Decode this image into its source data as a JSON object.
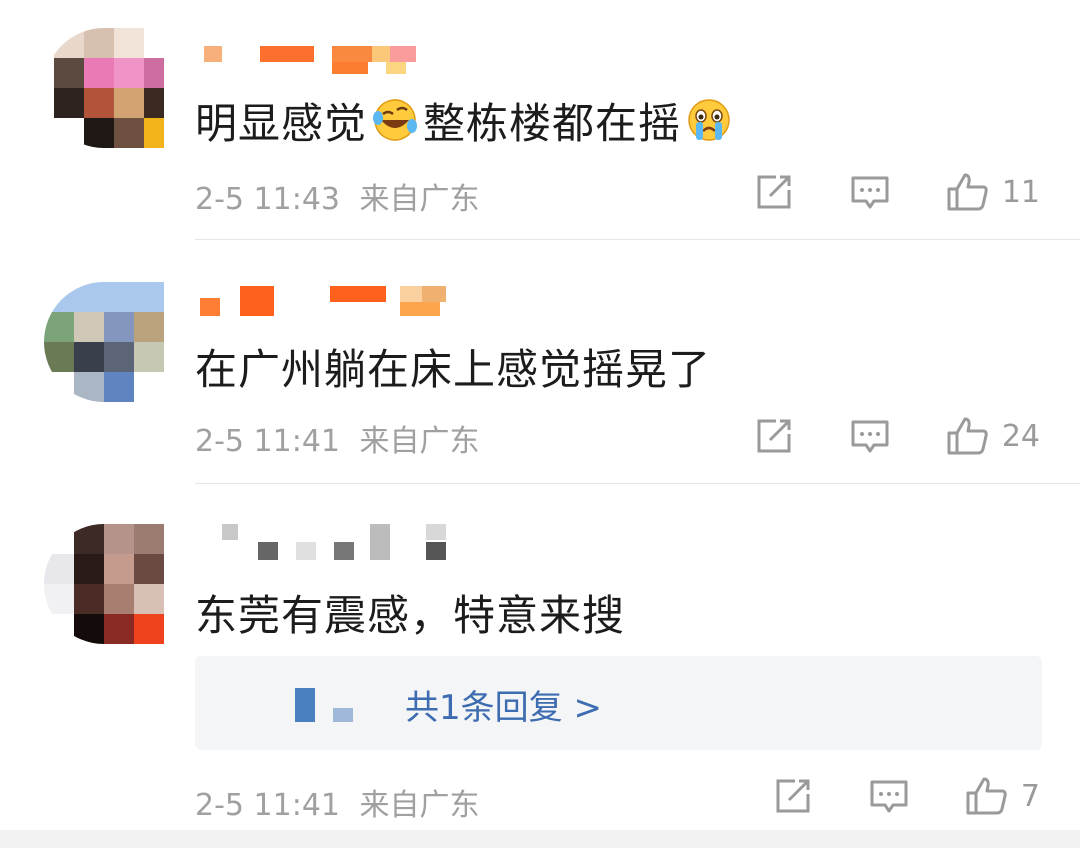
{
  "comments": [
    {
      "text_before_emoji": "明显感觉",
      "text_after_emoji": "整栋楼都在摇",
      "emoji_1": "laughing-crying-emoji",
      "emoji_2": "crying-emoji",
      "timestamp": "2-5 11:43",
      "location": "来自广东",
      "likes": "11"
    },
    {
      "text": "在广州躺在床上感觉摇晃了",
      "timestamp": "2-5 11:41",
      "location": "来自广东",
      "likes": "24"
    },
    {
      "text": "东莞有震感，特意来搜",
      "reply_summary": "共1条回复 >",
      "timestamp": "2-5 11:41",
      "location": "来自广东",
      "likes": "7"
    }
  ],
  "icons": {
    "share": "share-icon",
    "comment": "comment-icon",
    "like": "thumbs-up-icon"
  },
  "colors": {
    "link": "#3d6cb0",
    "meta": "#a0a0a0",
    "text": "#1c1c1c"
  }
}
